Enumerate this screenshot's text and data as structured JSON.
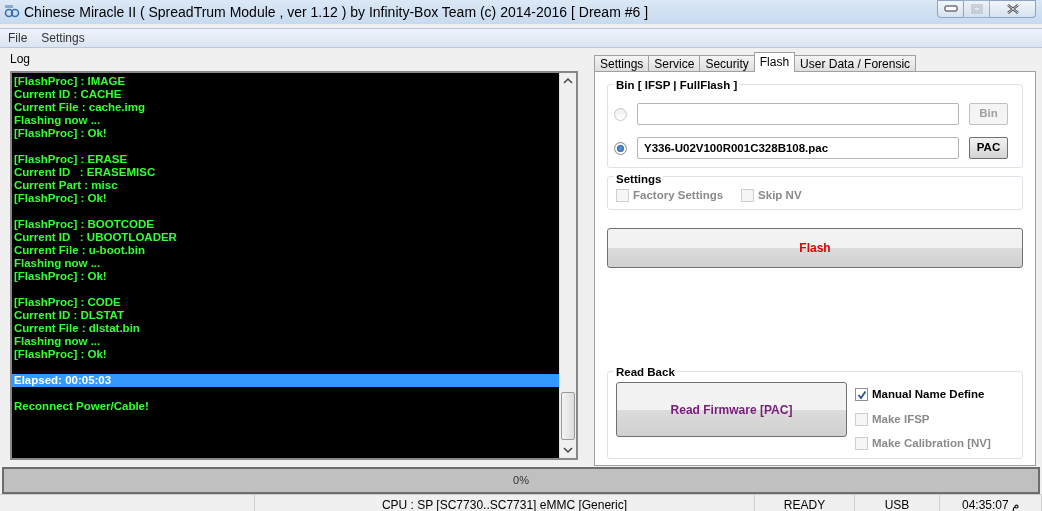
{
  "window": {
    "title": "Chinese Miracle II ( SpreadTrum Module , ver 1.12 ) by Infinity-Box Team (c) 2014-2016 [ Dream #6 ]",
    "buttons": [
      {
        "kind": "minimize",
        "disabled": false
      },
      {
        "kind": "maximize",
        "disabled": true
      },
      {
        "kind": "close",
        "disabled": false
      }
    ]
  },
  "menu": [
    "File",
    "Settings"
  ],
  "log": {
    "label": "Log",
    "blocks": [
      {
        "selected": false,
        "lines": [
          "[FlashProc] : IMAGE",
          "Current ID : CACHE",
          "Current File : cache.img",
          "Flashing now ...",
          "[FlashProc] : Ok!"
        ]
      },
      {
        "selected": false,
        "lines": [
          "[FlashProc] : ERASE",
          "Current ID   : ERASEMISC",
          "Current Part : misc",
          "[FlashProc] : Ok!"
        ]
      },
      {
        "selected": false,
        "lines": [
          "[FlashProc] : BOOTCODE",
          "Current ID   : UBOOTLOADER",
          "Current File : u-boot.bin",
          "Flashing now ...",
          "[FlashProc] : Ok!"
        ]
      },
      {
        "selected": false,
        "lines": [
          "[FlashProc] : CODE",
          "Current ID : DLSTAT",
          "Current File : dlstat.bin",
          "Flashing now ...",
          "[FlashProc] : Ok!"
        ]
      },
      {
        "selected": true,
        "lines": [
          "Elapsed: 00:05:03"
        ]
      },
      {
        "selected": false,
        "lines": [
          "Reconnect Power/Cable!"
        ]
      }
    ]
  },
  "tabs": [
    {
      "label": "Settings",
      "selected": false
    },
    {
      "label": "Service",
      "selected": false
    },
    {
      "label": "Security",
      "selected": false
    },
    {
      "label": "Flash",
      "selected": true
    },
    {
      "label": "User Data / Forensic",
      "selected": false
    }
  ],
  "bin_group": {
    "title": "Bin  [ IFSP | FullFlash ]",
    "rows": [
      {
        "selected": false,
        "disabled": true,
        "button": "Bin"
      },
      {
        "selected": true,
        "disabled": false,
        "value": "Y336-U02V100R001C328B108.pac",
        "button": "PAC"
      }
    ]
  },
  "settings_group": {
    "title": "Settings",
    "options": [
      {
        "label": "Factory Settings",
        "checked": false,
        "disabled": true
      },
      {
        "label": "Skip NV",
        "checked": false,
        "disabled": true
      }
    ]
  },
  "flash_button": "Flash",
  "read_back": {
    "title": "Read Back",
    "button": "Read Firmware [PAC]",
    "options": [
      {
        "label": "Manual Name Define",
        "checked": true,
        "disabled": false
      },
      {
        "label": "Make IFSP",
        "checked": false,
        "disabled": true
      },
      {
        "label": "Make Calibration [NV]",
        "checked": false,
        "disabled": true
      }
    ]
  },
  "progress": {
    "level": 0,
    "reading": "0%"
  },
  "status_bar": [
    "CPU : SP [SC7730..SC7731] eMMC [Generic]",
    "READY",
    "USB",
    "04:35:07 م"
  ]
}
